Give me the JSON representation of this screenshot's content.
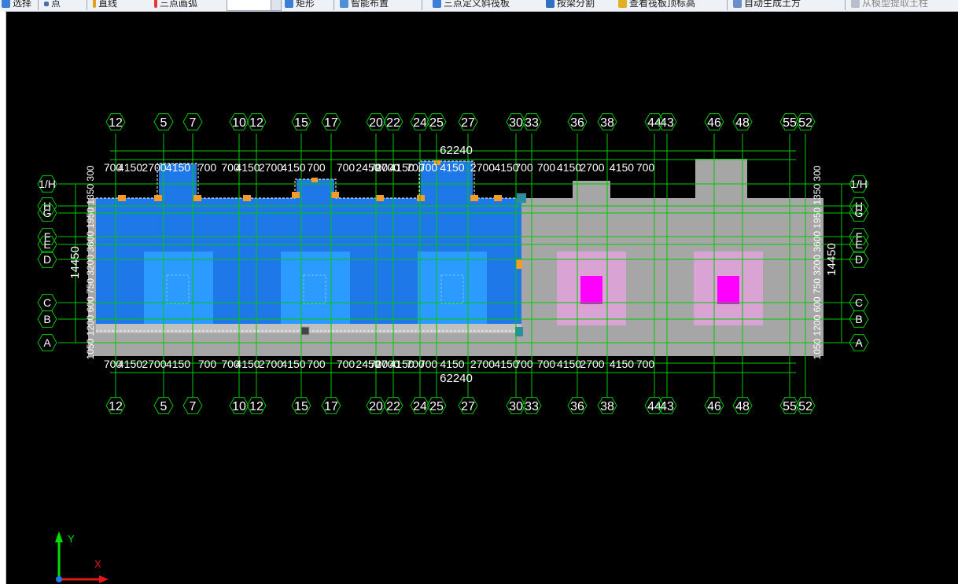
{
  "toolbar": {
    "items": [
      {
        "label": "选择",
        "icon": "select-arrow-icon"
      },
      {
        "label": "点",
        "icon": "point-icon"
      },
      {
        "label": "直线",
        "icon": "line-icon"
      },
      {
        "label": "三点画弧",
        "icon": "arc-icon"
      },
      {
        "label": "矩形",
        "icon": "rectangle-icon"
      },
      {
        "label": "智能布置",
        "icon": "smart-layout-icon"
      },
      {
        "label": "三点定义斜筏板",
        "icon": "slope-raft-icon"
      },
      {
        "label": "按梁分割",
        "icon": "split-by-beam-icon"
      },
      {
        "label": "查看筏板顶标高",
        "icon": "view-elevation-icon"
      },
      {
        "label": "自动生成土方",
        "icon": "auto-earthwork-icon"
      },
      {
        "label": "从模型提取土柱",
        "icon": "extract-column-icon"
      }
    ],
    "combo_value": ""
  },
  "drawing": {
    "total_dim": "62240",
    "depth_dim": "14450",
    "top_dims": [
      "700",
      "4150",
      "2700",
      "4150",
      "700",
      "700",
      "4150",
      "2700",
      "4150",
      "700",
      "700",
      "2450",
      "700",
      "2700",
      "4150",
      "700",
      "700",
      "4150",
      "2700",
      "4150",
      "700",
      "700",
      "4150",
      "2700",
      "4150",
      "700"
    ],
    "bottom_dims": [
      "700",
      "4150",
      "2700",
      "4150",
      "700",
      "700",
      "4150",
      "2700",
      "4150",
      "700",
      "700",
      "2450",
      "700",
      "2700",
      "4150",
      "700",
      "700",
      "4150",
      "2700",
      "4150",
      "700",
      "700",
      "4150",
      "2700",
      "4150",
      "700"
    ],
    "col_axes": [
      "12",
      "5",
      "7",
      "10",
      "12",
      "15",
      "17",
      "20",
      "22",
      "24",
      "25",
      "27",
      "30",
      "33",
      "36",
      "38",
      "44",
      "43",
      "46",
      "48",
      "55",
      "52"
    ],
    "row_axes": [
      "1/H",
      "H",
      "G",
      "F",
      "E",
      "D",
      "C",
      "B",
      "A"
    ],
    "side_dims_left": "1050 1200 600 750 3200 3600 1950 1350 300",
    "side_dims_right": "1050 1200 600 750 3200 3600 1950 1350 300",
    "ucs": {
      "x": "X",
      "y": "Y"
    }
  },
  "colors": {
    "background": "#000000",
    "raft": "#1e78e8",
    "raft_light": "#2c9bff",
    "slab": "#a6a6a6",
    "pink": "#d9a3d3",
    "magenta": "#ff00ff",
    "axis": "#00c800",
    "gridline": "#e01818"
  }
}
